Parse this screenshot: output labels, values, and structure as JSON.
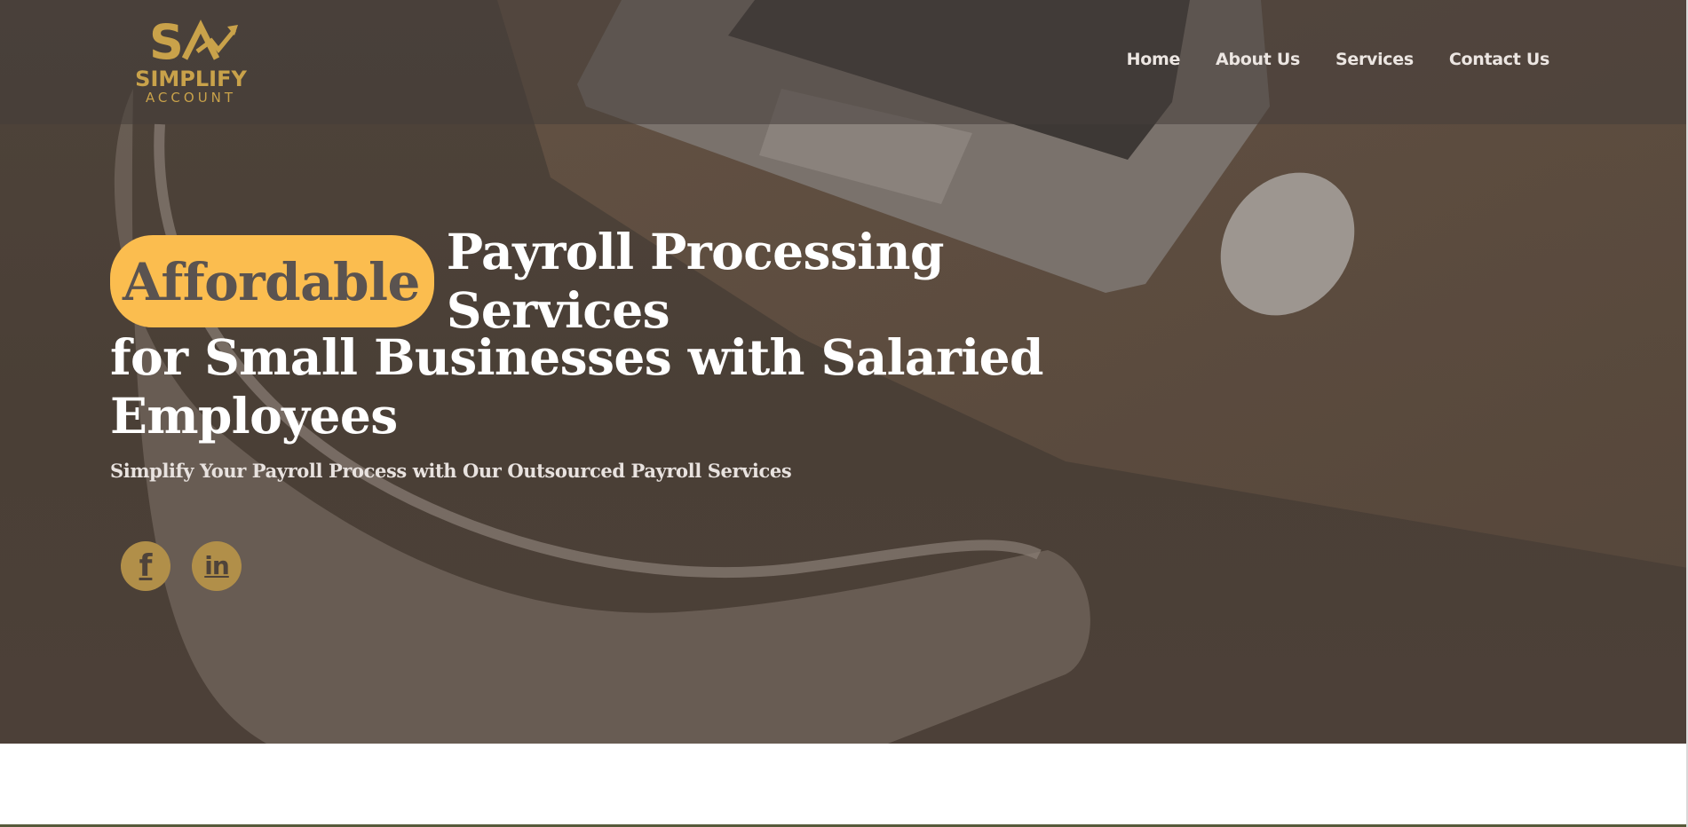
{
  "logo": {
    "title": "SIMPLIFY",
    "subtitle": "ACCOUNT",
    "mark_text": "SA",
    "color": "#c9a24a"
  },
  "nav": {
    "items": [
      {
        "label": "Home"
      },
      {
        "label": "About Us"
      },
      {
        "label": "Services"
      },
      {
        "label": "Contact Us"
      }
    ]
  },
  "hero": {
    "highlight": "Affordable",
    "headline_line1": "Payroll Processing Services",
    "headline_line2": "for Small Businesses with Salaried",
    "headline_line3": "Employees",
    "subheading": "Simplify Your Payroll Process with Our Outsourced Payroll Services",
    "highlight_color": "#fbbd4f"
  },
  "social": {
    "facebook": {
      "icon": "facebook-icon",
      "glyph": "f"
    },
    "linkedin": {
      "icon": "linkedin-icon",
      "glyph": "in"
    },
    "color": "#b18f49"
  },
  "colors": {
    "overlay": "#4e433a",
    "nav_text": "#ece6e2"
  }
}
